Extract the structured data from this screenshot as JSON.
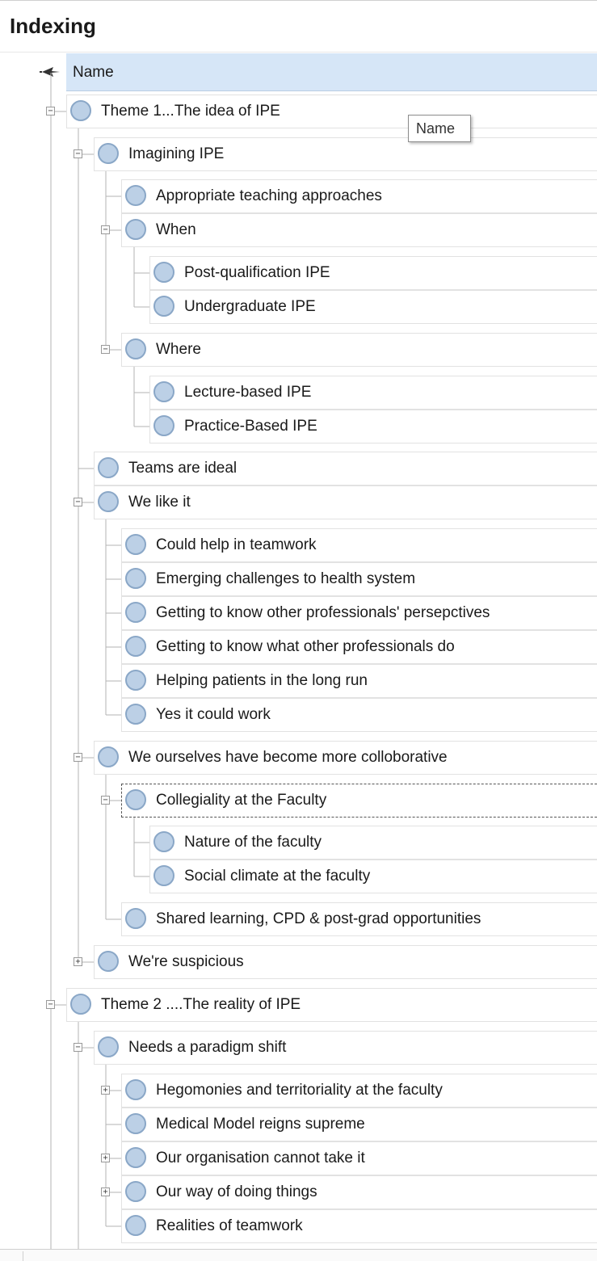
{
  "panel": {
    "title": "Indexing"
  },
  "header": {
    "column_name": "Name"
  },
  "tooltip": {
    "text": "Name"
  },
  "nodes": [
    {
      "label": "Theme 1...The idea of IPE",
      "depth": 0,
      "expander": "minus",
      "selected": false
    },
    {
      "label": "Imagining IPE",
      "depth": 1,
      "expander": "minus",
      "selected": false
    },
    {
      "label": "Appropriate teaching approaches",
      "depth": 2,
      "expander": "none",
      "selected": false
    },
    {
      "label": "When",
      "depth": 2,
      "expander": "minus",
      "selected": false
    },
    {
      "label": "Post-qualification IPE",
      "depth": 3,
      "expander": "none",
      "selected": false
    },
    {
      "label": "Undergraduate IPE",
      "depth": 3,
      "expander": "none",
      "selected": false
    },
    {
      "label": "Where",
      "depth": 2,
      "expander": "minus",
      "selected": false
    },
    {
      "label": "Lecture-based IPE",
      "depth": 3,
      "expander": "none",
      "selected": false
    },
    {
      "label": "Practice-Based IPE",
      "depth": 3,
      "expander": "none",
      "selected": false
    },
    {
      "label": "Teams are ideal",
      "depth": 1,
      "expander": "none",
      "selected": false
    },
    {
      "label": "We like it",
      "depth": 1,
      "expander": "minus",
      "selected": false
    },
    {
      "label": "Could help in teamwork",
      "depth": 2,
      "expander": "none",
      "selected": false
    },
    {
      "label": "Emerging challenges to health system",
      "depth": 2,
      "expander": "none",
      "selected": false
    },
    {
      "label": "Getting to know other professionals' persepctives",
      "depth": 2,
      "expander": "none",
      "selected": false
    },
    {
      "label": "Getting to know what other professionals do",
      "depth": 2,
      "expander": "none",
      "selected": false
    },
    {
      "label": "Helping patients in the long run",
      "depth": 2,
      "expander": "none",
      "selected": false
    },
    {
      "label": "Yes it could work",
      "depth": 2,
      "expander": "none",
      "selected": false
    },
    {
      "label": "We ourselves have become more colloborative",
      "depth": 1,
      "expander": "minus",
      "selected": false
    },
    {
      "label": "Collegiality at the Faculty",
      "depth": 2,
      "expander": "minus",
      "selected": true
    },
    {
      "label": "Nature of the faculty",
      "depth": 3,
      "expander": "none",
      "selected": false
    },
    {
      "label": "Social climate at the faculty",
      "depth": 3,
      "expander": "none",
      "selected": false
    },
    {
      "label": "Shared learning, CPD &  post-grad  opportunities",
      "depth": 2,
      "expander": "none",
      "selected": false
    },
    {
      "label": "We're suspicious",
      "depth": 1,
      "expander": "plus",
      "selected": false
    },
    {
      "label": "Theme 2 ....The reality of IPE",
      "depth": 0,
      "expander": "minus",
      "selected": false
    },
    {
      "label": "Needs a paradigm shift",
      "depth": 1,
      "expander": "minus",
      "selected": false
    },
    {
      "label": "Hegomonies and territoriality at the faculty",
      "depth": 2,
      "expander": "plus",
      "selected": false
    },
    {
      "label": "Medical Model reigns supreme",
      "depth": 2,
      "expander": "none",
      "selected": false
    },
    {
      "label": "Our organisation cannot take it",
      "depth": 2,
      "expander": "plus",
      "selected": false
    },
    {
      "label": "Our way of doing things",
      "depth": 2,
      "expander": "plus",
      "selected": false
    },
    {
      "label": "Realities of teamwork",
      "depth": 2,
      "expander": "none",
      "selected": false
    }
  ],
  "colors": {
    "header_background": "#d6e6f7",
    "node_fill": "#bcd0e6",
    "node_border": "#8aa7c7"
  }
}
